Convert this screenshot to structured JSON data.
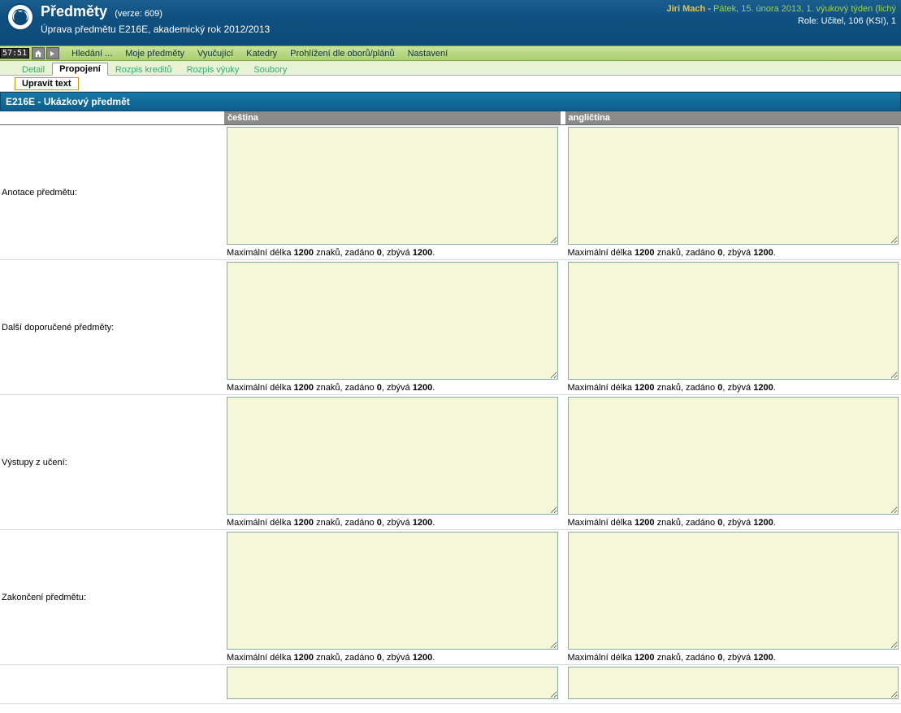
{
  "header": {
    "title": "Předměty",
    "version": "(verze: 609)",
    "subtitle": "Úprava předmětu E216E, akademický rok 2012/2013",
    "user": "Jiri Mach",
    "sep": " - ",
    "date": "Pátek, 15. února 2013, 1. výukový týden (lichý",
    "role": "Role: Učitel, 106 (KSI), 1"
  },
  "toolbar": {
    "badge": "57:51",
    "menu": [
      "Hledání ...",
      "Moje předměty",
      "Vyučující",
      "Katedry",
      "Prohlížení dle oborů/plánů",
      "Nastavení"
    ]
  },
  "tabs1": {
    "items": [
      "Detail",
      "Propojení",
      "Rozpis kreditů",
      "Rozpis výuky",
      "Soubory"
    ],
    "active": 1
  },
  "tabs2": {
    "items": [
      "Upravit text"
    ]
  },
  "pagetitle": "E216E - Ukázkový předmět",
  "cols": {
    "label": "",
    "cz": "čeština",
    "en": "angličtina"
  },
  "charinfo": {
    "p1": "Maximální délka ",
    "max": "1200",
    "p2": " znaků, zadáno ",
    "entered": "0",
    "p3": ", zbývá ",
    "remain": "1200",
    "p4": "."
  },
  "rows": [
    {
      "label": "Anotace předmětu:"
    },
    {
      "label": "Další doporučené předměty:"
    },
    {
      "label": "Výstupy z učení:"
    },
    {
      "label": "Zakončení předmětu:"
    },
    {
      "label": ""
    }
  ]
}
